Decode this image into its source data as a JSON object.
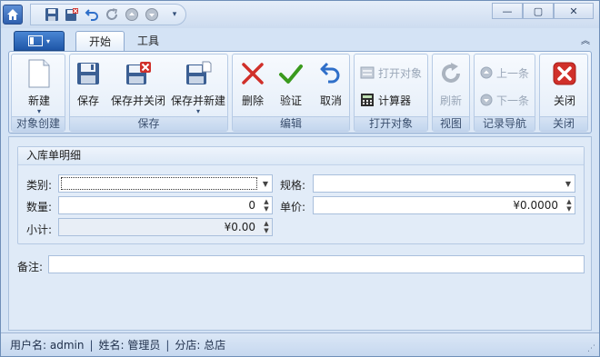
{
  "toolbar": {
    "icons": [
      "home-icon",
      "save-icon",
      "save-close-icon",
      "undo-icon",
      "redo-icon",
      "up-icon",
      "down-icon"
    ]
  },
  "tabs": [
    "开始",
    "工具"
  ],
  "ribbon": {
    "groups": {
      "create": "对象创建",
      "save": "保存",
      "edit": "编辑",
      "open": "打开对象",
      "view": "视图",
      "nav": "记录导航",
      "close": "关闭"
    },
    "buttons": {
      "new": "新建",
      "save": "保存",
      "save_close": "保存并关闭",
      "save_new": "保存并新建",
      "delete": "删除",
      "verify": "验证",
      "cancel": "取消",
      "open_object": "打开对象",
      "calculator": "计算器",
      "refresh": "刷新",
      "prev": "上一条",
      "next": "下一条",
      "close": "关闭"
    }
  },
  "form": {
    "section_title": "入库单明细",
    "category_label": "类别:",
    "category_value": "",
    "spec_label": "规格:",
    "spec_value": "",
    "qty_label": "数量:",
    "qty_value": "0",
    "price_label": "单价:",
    "price_value": "¥0.0000",
    "subtotal_label": "小计:",
    "subtotal_value": "¥0.00",
    "remark_label": "备注:",
    "remark_value": ""
  },
  "status": {
    "user": "用户名: admin",
    "name": "姓名: 管理员",
    "branch": "分店: 总店",
    "separator": "|"
  },
  "colors": {
    "accent": "#2e5fae",
    "delete_red": "#d0302a",
    "verify_green": "#3a9a1e",
    "cancel_blue": "#2f6fc9"
  }
}
